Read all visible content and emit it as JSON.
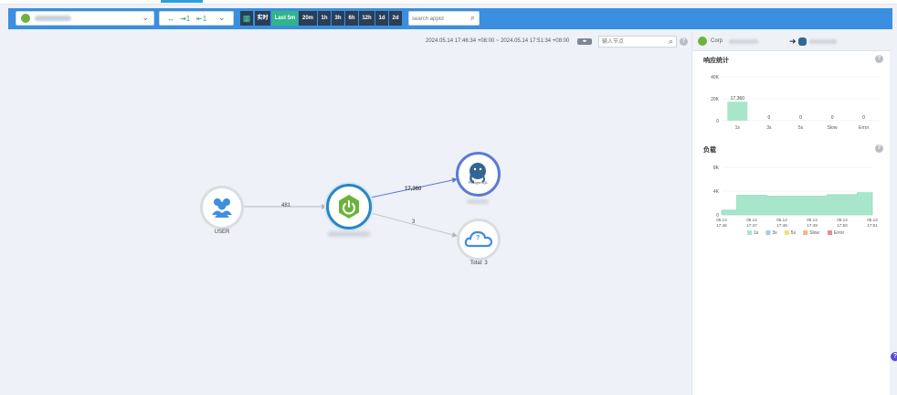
{
  "toolbar": {
    "app_selector": {
      "caret": "⌄"
    },
    "inout": {
      "arrows": "↔",
      "inbound": "⇥1",
      "outbound": "⇤1",
      "caret": "⌄"
    },
    "calendar_icon": "calendar-icon",
    "realtime_label": "实时",
    "ranges": [
      "Last 5m",
      "20m",
      "1h",
      "3h",
      "6h",
      "12h",
      "1d",
      "2d"
    ],
    "active_range": "Last 5m",
    "search_placeholder": "search appId"
  },
  "time_range": {
    "text": "2024.05.14 17:46:34 +08:00 ~ 2024.05.14 17:51:34 +08:00",
    "buttons": "◂▸"
  },
  "node_search_placeholder": "输入节点",
  "graph": {
    "nodes": {
      "user": {
        "label": "USER"
      },
      "postgres": {
        "label": "PostgreSQL"
      },
      "cloud": {
        "label": "Total: 3",
        "badge": "?"
      }
    },
    "edges": {
      "user_to_app": "481",
      "app_to_postgres": "17,360",
      "app_to_cloud": "3"
    }
  },
  "panel": {
    "source_prefix": "Corp",
    "arrow": "➜",
    "response_title": "响应统计",
    "load_title": "负载",
    "help": "?"
  },
  "chart_data": [
    {
      "type": "bar",
      "title": "响应统计",
      "categories": [
        "1s",
        "3s",
        "5s",
        "Slow",
        "Error"
      ],
      "values": [
        17360,
        0,
        0,
        0,
        0
      ],
      "data_labels": [
        "17,360",
        "0",
        "0",
        "0",
        "0"
      ],
      "yticks": [
        "40K",
        "20K",
        "0"
      ],
      "ylim": [
        0,
        40000
      ],
      "color": "#a8e6cc"
    },
    {
      "type": "area",
      "title": "负载",
      "x": [
        "05.14 17:46",
        "05.14 17:47",
        "05.14 17:48",
        "05.14 17:49",
        "05.14 17:50",
        "05.14 17:51"
      ],
      "xticks": [
        [
          "05.14",
          "17:46"
        ],
        [
          "05.14",
          "17:47"
        ],
        [
          "05.14",
          "17:48"
        ],
        [
          "05.14",
          "17:49"
        ],
        [
          "05.14",
          "17:50"
        ],
        [
          "05.14",
          "17:51"
        ]
      ],
      "yticks": [
        "8K",
        "4K",
        "0"
      ],
      "ylim": [
        0,
        8000
      ],
      "series": [
        {
          "name": "1s",
          "values": [
            800,
            3300,
            3150,
            3150,
            3400,
            3750
          ],
          "color": "#a8e6cc"
        },
        {
          "name": "3s",
          "values": [
            0,
            0,
            0,
            0,
            0,
            0
          ],
          "color": "#aac7e8"
        },
        {
          "name": "5s",
          "values": [
            0,
            0,
            0,
            0,
            0,
            0
          ],
          "color": "#f6dc7c"
        },
        {
          "name": "Slow",
          "values": [
            0,
            0,
            0,
            0,
            0,
            0
          ],
          "color": "#f4b58a"
        },
        {
          "name": "Error",
          "values": [
            0,
            0,
            0,
            0,
            0,
            0
          ],
          "color": "#f08a8a"
        }
      ]
    }
  ]
}
